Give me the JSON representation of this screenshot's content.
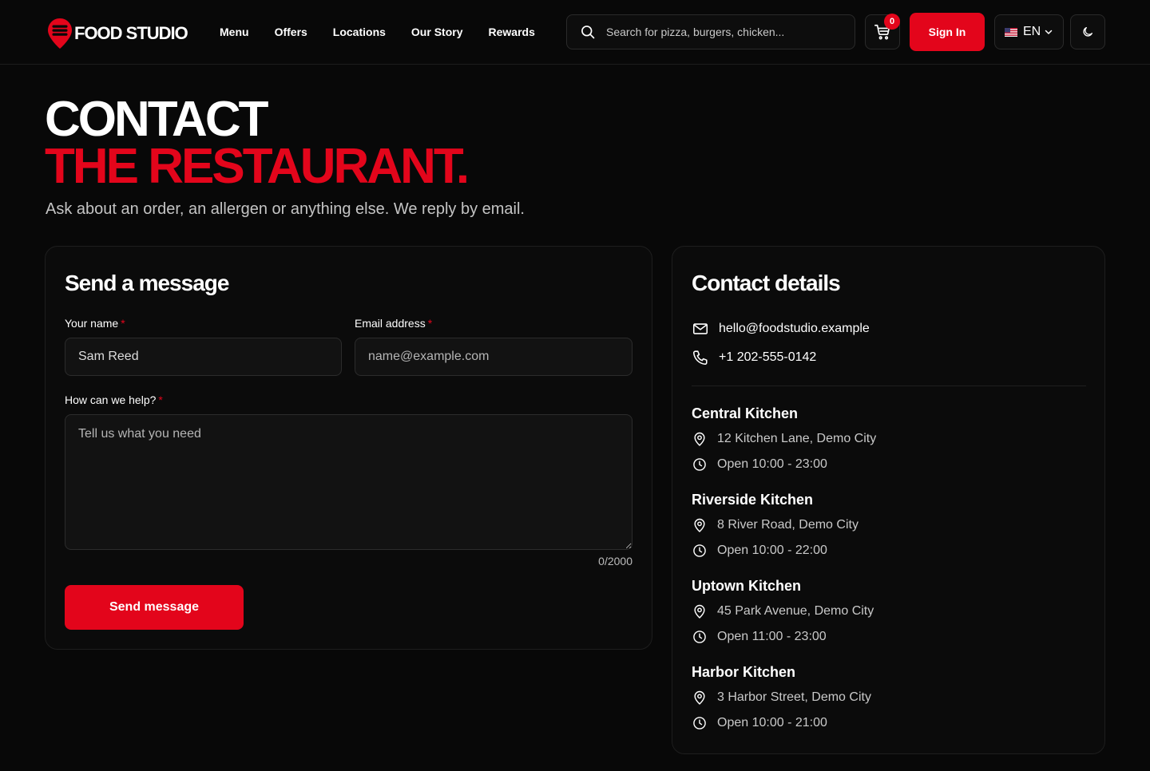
{
  "header": {
    "brand": "FOOD STUDIO",
    "nav": [
      "Menu",
      "Offers",
      "Locations",
      "Our Story",
      "Rewards"
    ],
    "search_placeholder": "Search for pizza, burgers, chicken...",
    "cart_count": "0",
    "sign_in": "Sign In",
    "language": "EN"
  },
  "hero": {
    "line1": "CONTACT",
    "line2": "THE RESTAURANT.",
    "subtitle": "Ask about an order, an allergen or anything else. We reply by email."
  },
  "form": {
    "title": "Send a message",
    "name_label": "Your name",
    "name_value": "Sam Reed",
    "email_label": "Email address",
    "email_placeholder": "name@example.com",
    "message_label": "How can we help?",
    "message_placeholder": "Tell us what you need",
    "required_mark": "*",
    "counter": "0/2000",
    "submit": "Send message"
  },
  "details": {
    "title": "Contact details",
    "email": "hello@foodstudio.example",
    "phone": "+1 202-555-0142",
    "kitchens": [
      {
        "name": "Central Kitchen",
        "address": "12 Kitchen Lane, Demo City",
        "hours": "Open 10:00 - 23:00"
      },
      {
        "name": "Riverside Kitchen",
        "address": "8 River Road, Demo City",
        "hours": "Open 10:00 - 22:00"
      },
      {
        "name": "Uptown Kitchen",
        "address": "45 Park Avenue, Demo City",
        "hours": "Open 11:00 - 23:00"
      },
      {
        "name": "Harbor Kitchen",
        "address": "3 Harbor Street, Demo City",
        "hours": "Open 10:00 - 21:00"
      }
    ]
  },
  "colors": {
    "accent": "#e3051b",
    "background": "#080808",
    "card": "#0b0b0b"
  },
  "icons": [
    "logo-pin-icon",
    "search-icon",
    "cart-icon",
    "us-flag-icon",
    "chevron-down-icon",
    "moon-icon",
    "mail-icon",
    "phone-icon",
    "location-pin-icon",
    "clock-icon"
  ]
}
